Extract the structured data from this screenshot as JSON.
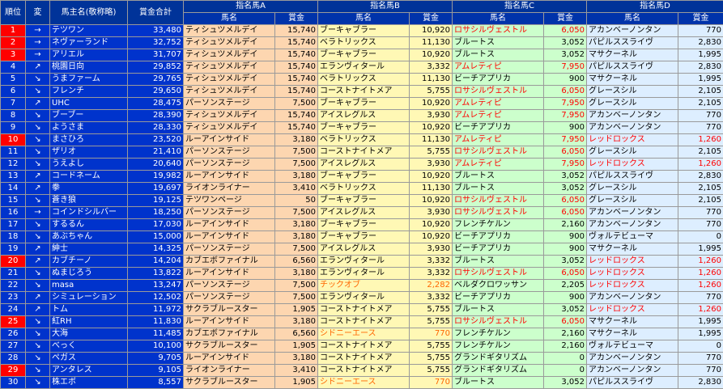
{
  "headers": {
    "rank": "順位",
    "change": "変",
    "owner": "馬主名(敬称略)",
    "total": "賞金合計",
    "groups": [
      "指名馬A",
      "指名馬B",
      "指名馬C",
      "指名馬D"
    ],
    "sub_name": "馬名",
    "sub_prize": "賞金"
  },
  "rows": [
    {
      "rank": "1",
      "hl": true,
      "arrow": "→",
      "owner": "テツワン",
      "total": "33,480",
      "a": [
        "ティシュツメルデイ",
        "15,740",
        ""
      ],
      "b": [
        "ブーキャブラー",
        "10,920",
        ""
      ],
      "c": [
        "ロサシルヴェストル",
        "6,050",
        "red"
      ],
      "d": [
        "アカンベーノンタン",
        "770",
        ""
      ]
    },
    {
      "rank": "2",
      "hl": true,
      "arrow": "→",
      "owner": "ネヴァーランド",
      "total": "32,752",
      "a": [
        "ティシュツメルデイ",
        "15,740",
        ""
      ],
      "b": [
        "ベラトリックス",
        "11,130",
        ""
      ],
      "c": [
        "ブルートス",
        "3,052",
        ""
      ],
      "d": [
        "パピルススライヴ",
        "2,830",
        ""
      ]
    },
    {
      "rank": "3",
      "hl": true,
      "arrow": "→",
      "owner": "アリエル",
      "total": "31,707",
      "a": [
        "ティシュツメルデイ",
        "15,740",
        ""
      ],
      "b": [
        "ブーキャブラー",
        "10,920",
        ""
      ],
      "c": [
        "ブルートス",
        "3,052",
        ""
      ],
      "d": [
        "マサクーネル",
        "1,995",
        ""
      ]
    },
    {
      "rank": "4",
      "hl": false,
      "arrow": "↗",
      "owner": "桃園日向",
      "total": "29,852",
      "a": [
        "ティシュツメルデイ",
        "15,740",
        ""
      ],
      "b": [
        "エランヴィタール",
        "3,332",
        ""
      ],
      "c": [
        "アムレティピ",
        "7,950",
        "red"
      ],
      "d": [
        "パピルススライヴ",
        "2,830",
        ""
      ]
    },
    {
      "rank": "5",
      "hl": false,
      "arrow": "↘",
      "owner": "うまファーム",
      "total": "29,765",
      "a": [
        "ティシュツメルデイ",
        "15,740",
        ""
      ],
      "b": [
        "ベラトリックス",
        "11,130",
        ""
      ],
      "c": [
        "ビーチアプリカ",
        "900",
        ""
      ],
      "d": [
        "マサクーネル",
        "1,995",
        ""
      ]
    },
    {
      "rank": "6",
      "hl": false,
      "arrow": "↘",
      "owner": "フレンチ",
      "total": "29,650",
      "a": [
        "ティシュツメルデイ",
        "15,740",
        ""
      ],
      "b": [
        "コーストナイトメア",
        "5,755",
        ""
      ],
      "c": [
        "ロサシルヴェストル",
        "6,050",
        "red"
      ],
      "d": [
        "グレースシル",
        "2,105",
        ""
      ]
    },
    {
      "rank": "7",
      "hl": false,
      "arrow": "↗",
      "owner": "UHC",
      "total": "28,475",
      "a": [
        "パーソンステージ",
        "7,500",
        ""
      ],
      "b": [
        "ブーキャブラー",
        "10,920",
        ""
      ],
      "c": [
        "アムレティピ",
        "7,950",
        "red"
      ],
      "d": [
        "グレースシル",
        "2,105",
        ""
      ]
    },
    {
      "rank": "8",
      "hl": false,
      "arrow": "↘",
      "owner": "ブーブー",
      "total": "28,390",
      "a": [
        "ティシュツメルデイ",
        "15,740",
        ""
      ],
      "b": [
        "アイスレグルス",
        "3,930",
        ""
      ],
      "c": [
        "アムレティピ",
        "7,950",
        "red"
      ],
      "d": [
        "アカンベーノンタン",
        "770",
        ""
      ]
    },
    {
      "rank": "9",
      "hl": false,
      "arrow": "↘",
      "owner": "ようさま",
      "total": "28,330",
      "a": [
        "ティシュツメルデイ",
        "15,740",
        ""
      ],
      "b": [
        "ブーキャブラー",
        "10,920",
        ""
      ],
      "c": [
        "ビーチアプリカ",
        "900",
        ""
      ],
      "d": [
        "アカンベーノンタン",
        "770",
        ""
      ]
    },
    {
      "rank": "10",
      "hl": true,
      "arrow": "↘",
      "owner": "まさひろ",
      "total": "23,520",
      "a": [
        "ルーアインサイド",
        "3,180",
        ""
      ],
      "b": [
        "ベラトリックス",
        "11,130",
        ""
      ],
      "c": [
        "アムレティピ",
        "7,950",
        "red"
      ],
      "d": [
        "レッドロックス",
        "1,260",
        "red"
      ]
    },
    {
      "rank": "11",
      "hl": false,
      "arrow": "↘",
      "owner": "ザリオ",
      "total": "21,410",
      "a": [
        "パーソンステージ",
        "7,500",
        ""
      ],
      "b": [
        "コーストナイトメア",
        "5,755",
        ""
      ],
      "c": [
        "ロサシルヴェストル",
        "6,050",
        "red"
      ],
      "d": [
        "グレースシル",
        "2,105",
        ""
      ]
    },
    {
      "rank": "12",
      "hl": false,
      "arrow": "↘",
      "owner": "うえよし",
      "total": "20,640",
      "a": [
        "パーソンステージ",
        "7,500",
        ""
      ],
      "b": [
        "アイスレグルス",
        "3,930",
        ""
      ],
      "c": [
        "アムレティピ",
        "7,950",
        "red"
      ],
      "d": [
        "レッドロックス",
        "1,260",
        "red"
      ]
    },
    {
      "rank": "13",
      "hl": false,
      "arrow": "↗",
      "owner": "コードネーム",
      "total": "19,982",
      "a": [
        "ルーアインサイド",
        "3,180",
        ""
      ],
      "b": [
        "ブーキャブラー",
        "10,920",
        ""
      ],
      "c": [
        "ブルートス",
        "3,052",
        ""
      ],
      "d": [
        "パピルススライヴ",
        "2,830",
        ""
      ]
    },
    {
      "rank": "14",
      "hl": false,
      "arrow": "↗",
      "owner": "拳",
      "total": "19,697",
      "a": [
        "ライオンライナー",
        "3,410",
        ""
      ],
      "b": [
        "ベラトリックス",
        "11,130",
        ""
      ],
      "c": [
        "ブルートス",
        "3,052",
        ""
      ],
      "d": [
        "グレースシル",
        "2,105",
        ""
      ]
    },
    {
      "rank": "15",
      "hl": false,
      "arrow": "↘",
      "owner": "蒼き狼",
      "total": "19,125",
      "a": [
        "テツワンページ",
        "50",
        ""
      ],
      "b": [
        "ブーキャブラー",
        "10,920",
        ""
      ],
      "c": [
        "ロサシルヴェストル",
        "6,050",
        "red"
      ],
      "d": [
        "グレースシル",
        "2,105",
        ""
      ]
    },
    {
      "rank": "16",
      "hl": false,
      "arrow": "→",
      "owner": "コインドシルバー",
      "total": "18,250",
      "a": [
        "パーソンステージ",
        "7,500",
        ""
      ],
      "b": [
        "アイスレグルス",
        "3,930",
        ""
      ],
      "c": [
        "ロサシルヴェストル",
        "6,050",
        "red"
      ],
      "d": [
        "アカンベーノンタン",
        "770",
        ""
      ]
    },
    {
      "rank": "17",
      "hl": false,
      "arrow": "↘",
      "owner": "するるん",
      "total": "17,030",
      "a": [
        "ルーアインサイド",
        "3,180",
        ""
      ],
      "b": [
        "ブーキャブラー",
        "10,920",
        ""
      ],
      "c": [
        "フレンチケルン",
        "2,160",
        ""
      ],
      "d": [
        "アカンベーノンタン",
        "770",
        ""
      ]
    },
    {
      "rank": "18",
      "hl": false,
      "arrow": "↘",
      "owner": "あぶちゃん",
      "total": "15,000",
      "a": [
        "ルーアインサイド",
        "3,180",
        ""
      ],
      "b": [
        "ブーキャブラー",
        "10,920",
        ""
      ],
      "c": [
        "ビーチアプリカ",
        "900",
        ""
      ],
      "d": [
        "ヴォルテビューマ",
        "0",
        ""
      ]
    },
    {
      "rank": "19",
      "hl": false,
      "arrow": "↗",
      "owner": "紳士",
      "total": "14,325",
      "a": [
        "パーソンステージ",
        "7,500",
        ""
      ],
      "b": [
        "アイスレグルス",
        "3,930",
        ""
      ],
      "c": [
        "ビーチアプリカ",
        "900",
        ""
      ],
      "d": [
        "マサクーネル",
        "1,995",
        ""
      ]
    },
    {
      "rank": "20",
      "hl": true,
      "arrow": "↗",
      "owner": "カブチーノ",
      "total": "14,204",
      "a": [
        "カブエボファイナル",
        "6,560",
        ""
      ],
      "b": [
        "エランヴィタール",
        "3,332",
        ""
      ],
      "c": [
        "ブルートス",
        "3,052",
        ""
      ],
      "d": [
        "レッドロックス",
        "1,260",
        "red"
      ]
    },
    {
      "rank": "21",
      "hl": false,
      "arrow": "↘",
      "owner": "ぬまじろう",
      "total": "13,822",
      "a": [
        "ルーアインサイド",
        "3,180",
        ""
      ],
      "b": [
        "エランヴィタール",
        "3,332",
        ""
      ],
      "c": [
        "ロサシルヴェストル",
        "6,050",
        "red"
      ],
      "d": [
        "レッドロックス",
        "1,260",
        "red"
      ]
    },
    {
      "rank": "22",
      "hl": false,
      "arrow": "↘",
      "owner": "masa",
      "total": "13,247",
      "a": [
        "パーソンステージ",
        "7,500",
        ""
      ],
      "b": [
        "チックオブ",
        "2,282",
        "orange"
      ],
      "c": [
        "ベルダクロワッサン",
        "2,205",
        ""
      ],
      "d": [
        "レッドロックス",
        "1,260",
        "red"
      ]
    },
    {
      "rank": "23",
      "hl": false,
      "arrow": "↗",
      "owner": "シミュレーション",
      "total": "12,502",
      "a": [
        "パーソンステージ",
        "7,500",
        ""
      ],
      "b": [
        "エランヴィタール",
        "3,332",
        ""
      ],
      "c": [
        "ビーチアプリカ",
        "900",
        ""
      ],
      "d": [
        "アカンベーノンタン",
        "770",
        ""
      ]
    },
    {
      "rank": "24",
      "hl": false,
      "arrow": "↗",
      "owner": "トム",
      "total": "11,972",
      "a": [
        "サクラブルースター",
        "1,905",
        ""
      ],
      "b": [
        "コーストナイトメア",
        "5,755",
        ""
      ],
      "c": [
        "ブルートス",
        "3,052",
        ""
      ],
      "d": [
        "レッドロックス",
        "1,260",
        "red"
      ]
    },
    {
      "rank": "25",
      "hl": true,
      "arrow": "↘",
      "owner": "紅RH",
      "total": "11,830",
      "a": [
        "ルーアインサイド",
        "3,180",
        ""
      ],
      "b": [
        "コーストナイトメア",
        "5,755",
        ""
      ],
      "c": [
        "ロサシルヴェストル",
        "6,050",
        "red"
      ],
      "d": [
        "マサクーネル",
        "1,995",
        ""
      ]
    },
    {
      "rank": "26",
      "hl": false,
      "arrow": "↘",
      "owner": "大海",
      "total": "11,485",
      "a": [
        "カブエボファイナル",
        "6,560",
        ""
      ],
      "b": [
        "シドニーエース",
        "770",
        "orange"
      ],
      "c": [
        "フレンチケルン",
        "2,160",
        ""
      ],
      "d": [
        "マサクーネル",
        "1,995",
        ""
      ]
    },
    {
      "rank": "27",
      "hl": false,
      "arrow": "↘",
      "owner": "べっく",
      "total": "10,100",
      "a": [
        "サクラブルースター",
        "1,905",
        ""
      ],
      "b": [
        "コーストナイトメア",
        "5,755",
        ""
      ],
      "c": [
        "フレンチケルン",
        "2,160",
        ""
      ],
      "d": [
        "ヴォルテビューマ",
        "0",
        ""
      ]
    },
    {
      "rank": "28",
      "hl": false,
      "arrow": "↘",
      "owner": "ペガス",
      "total": "9,705",
      "a": [
        "ルーアインサイド",
        "3,180",
        ""
      ],
      "b": [
        "コーストナイトメア",
        "5,755",
        ""
      ],
      "c": [
        "グランドギタリズム",
        "0",
        ""
      ],
      "d": [
        "アカンベーノンタン",
        "770",
        ""
      ]
    },
    {
      "rank": "29",
      "hl": true,
      "arrow": "↘",
      "owner": "アンタレス",
      "total": "9,105",
      "a": [
        "ライオンライナー",
        "3,410",
        ""
      ],
      "b": [
        "コーストナイトメア",
        "5,755",
        ""
      ],
      "c": [
        "グランドギタリズム",
        "0",
        ""
      ],
      "d": [
        "アカンベーノンタン",
        "770",
        ""
      ]
    },
    {
      "rank": "30",
      "hl": false,
      "arrow": "↘",
      "owner": "株エボ",
      "total": "8,557",
      "a": [
        "サクラブルースター",
        "1,905",
        ""
      ],
      "b": [
        "シドニーエース",
        "770",
        "orange"
      ],
      "c": [
        "ブルートス",
        "3,052",
        ""
      ],
      "d": [
        "パピルススライヴ",
        "2,830",
        ""
      ]
    }
  ]
}
